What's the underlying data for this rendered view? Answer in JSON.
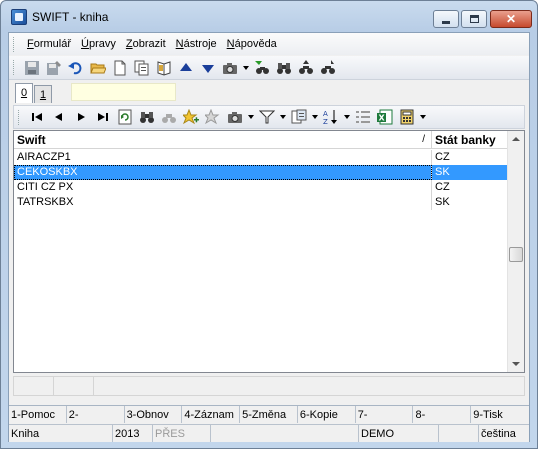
{
  "window": {
    "title": "SWIFT - kniha"
  },
  "menu": [
    "Formulář",
    "Úpravy",
    "Zobrazit",
    "Nástroje",
    "Nápověda"
  ],
  "main_toolbar": {
    "icons": [
      "save-icon",
      "save-as-icon",
      "undo-icon",
      "open-folder-icon",
      "new-document-icon",
      "copy-icon",
      "book-icon",
      "arrow-up-icon",
      "arrow-down-icon",
      "camera-icon",
      "filter-binoculars-icon",
      "binoculars-icon",
      "binoculars-prev-icon",
      "binoculars-next-icon"
    ]
  },
  "tabs": [
    {
      "label": "0",
      "active": true
    },
    {
      "label": "1",
      "active": false
    }
  ],
  "grid_toolbar": {
    "icons": [
      "first-record-icon",
      "prev-record-icon",
      "next-record-icon",
      "last-record-icon",
      "refresh-icon",
      "binoculars-icon",
      "binoculars-disabled-icon",
      "bookmark-add-icon",
      "bookmark-remove-icon",
      "camera-icon",
      "filter-icon",
      "columns-icon",
      "sort-az-icon",
      "list-icon",
      "excel-icon",
      "calculator-icon"
    ]
  },
  "grid": {
    "columns": [
      "Swift",
      "Stát banky"
    ],
    "sort_indicator": "/",
    "rows": [
      {
        "swift": "AIRACZP1",
        "stat": "CZ",
        "selected": false
      },
      {
        "swift": "CEKOSKBX",
        "stat": "SK",
        "selected": true
      },
      {
        "swift": "CITI CZ PX",
        "stat": "CZ",
        "selected": false
      },
      {
        "swift": "TATRSKBX",
        "stat": "SK",
        "selected": false
      }
    ]
  },
  "function_keys": [
    "1-Pomoc",
    "2-",
    "3-Obnov",
    "4-Záznam",
    "5-Změna",
    "6-Kopie",
    "7-",
    "8-",
    "9-Tisk"
  ],
  "status": {
    "module": "Kniha",
    "year": "2013",
    "mode": "PŘES",
    "database": "DEMO",
    "language": "čeština"
  },
  "colors": {
    "selection": "#3399ff",
    "info_field": "#ffffe1"
  }
}
